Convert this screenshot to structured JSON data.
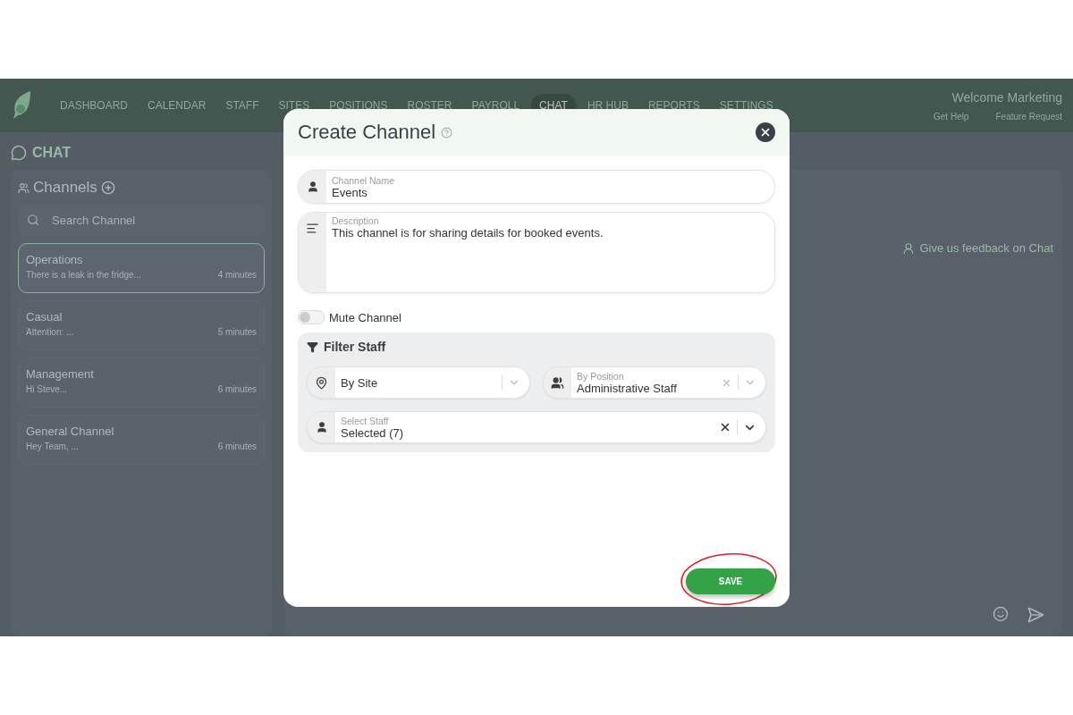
{
  "nav": {
    "items": [
      {
        "label": "DASHBOARD",
        "selected": false
      },
      {
        "label": "CALENDAR",
        "selected": false
      },
      {
        "label": "STAFF",
        "selected": false
      },
      {
        "label": "SITES",
        "selected": false
      },
      {
        "label": "POSITIONS",
        "selected": false
      },
      {
        "label": "ROSTER",
        "selected": false
      },
      {
        "label": "PAYROLL",
        "selected": false
      },
      {
        "label": "CHAT",
        "selected": true
      },
      {
        "label": "HR HUB",
        "selected": false
      },
      {
        "label": "REPORTS",
        "selected": false
      },
      {
        "label": "SETTINGS",
        "selected": false
      }
    ],
    "welcome": "Welcome Marketing",
    "links": [
      "Get Help",
      "Feature Request"
    ]
  },
  "page": {
    "title": "CHAT",
    "channels_title": "Channels",
    "search_placeholder": "Search Channel",
    "feedback": "Give us feedback on Chat",
    "channels": [
      {
        "name": "Operations",
        "preview": "There is a leak in the fridge...",
        "time": "4 minutes",
        "selected": true
      },
      {
        "name": "Casual",
        "preview": "Attention: ...",
        "time": "5 minutes",
        "selected": false
      },
      {
        "name": "Management",
        "preview": "Hi Steve...",
        "time": "6 minutes",
        "selected": false
      },
      {
        "name": "General Channel",
        "preview": "Hey Team, ...",
        "time": "6 minutes",
        "selected": false
      }
    ]
  },
  "modal": {
    "title": "Create Channel",
    "channel_name": {
      "label": "Channel Name",
      "value": "Events"
    },
    "description": {
      "label": "Description",
      "value": "This channel is for sharing details for booked events."
    },
    "mute": {
      "label": "Mute Channel",
      "on": false
    },
    "filter": {
      "title": "Filter Staff",
      "by_site": {
        "placeholder": "By Site"
      },
      "by_position": {
        "label": "By Position",
        "value": "Administrative Staff"
      },
      "select_staff": {
        "label": "Select Staff",
        "value": "Selected (7)"
      }
    },
    "save": "SAVE"
  }
}
